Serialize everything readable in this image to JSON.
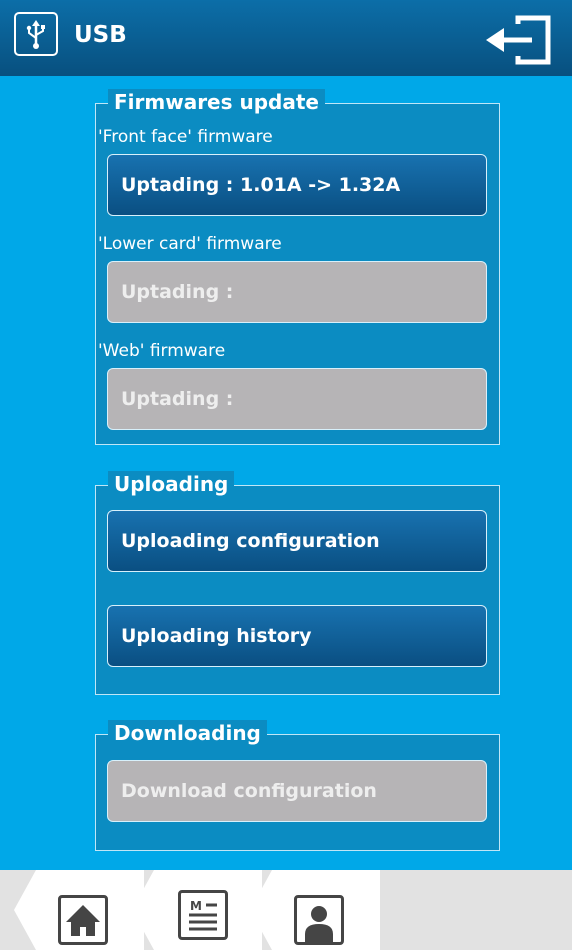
{
  "header": {
    "title": "USB",
    "usb_icon": "usb-icon",
    "logout_icon": "logout-icon"
  },
  "firmware": {
    "title": "Firmwares update",
    "front_label": "'Front face' firmware",
    "front_button": "Uptading : 1.01A -> 1.32A",
    "lower_label": "'Lower card' firmware",
    "lower_button": "Uptading :",
    "web_label": "'Web' firmware",
    "web_button": "Uptading :"
  },
  "uploading": {
    "title": "Uploading",
    "config_button": "Uploading configuration",
    "history_button": "Uploading history"
  },
  "downloading": {
    "title": "Downloading",
    "config_button": "Download configuration"
  },
  "bottom_nav": {
    "items": [
      "home-icon",
      "menu-icon",
      "user-icon"
    ]
  },
  "colors": {
    "background": "#00a8e8",
    "header": "#0c6ea8",
    "panel": "#0b8cc2",
    "button_active": "#1872b0",
    "button_disabled": "#b6b4b6",
    "bottom_bar": "#e2e2e2"
  }
}
